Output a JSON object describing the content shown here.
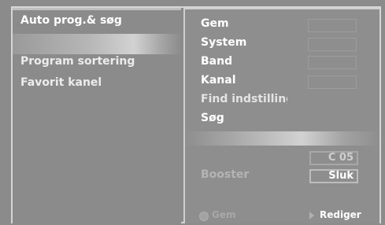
{
  "left_menu": {
    "items": [
      {
        "label": "Auto prog.& søg"
      },
      {
        "label": "Program  sortering"
      },
      {
        "label": "Favorit kanel"
      }
    ]
  },
  "right_panel": {
    "items": [
      {
        "label": "Gem"
      },
      {
        "label": "System"
      },
      {
        "label": "Band"
      },
      {
        "label": "Kanal"
      },
      {
        "label": "Find indstilling"
      },
      {
        "label": "Søg"
      }
    ],
    "channel_value": "C 05",
    "booster_label": "Booster",
    "booster_value": "Sluk"
  },
  "footer": {
    "gem_label": "Gem",
    "rediger_label": "Rediger"
  }
}
